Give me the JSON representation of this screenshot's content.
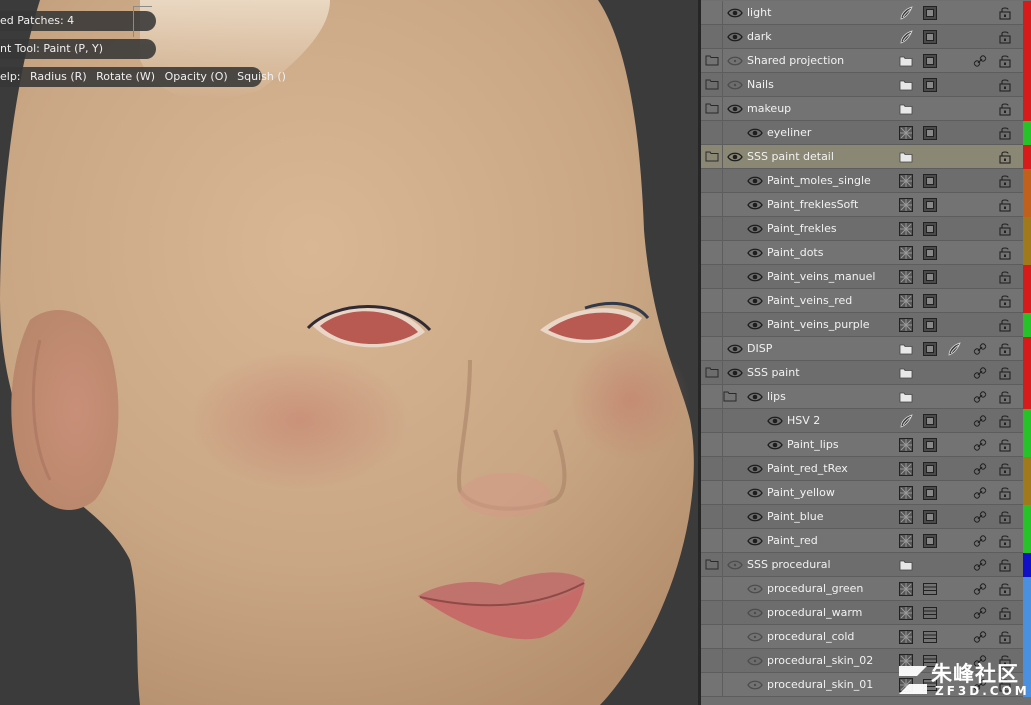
{
  "viewport": {
    "hud_patches": "ed Patches: 4",
    "hud_tool": "nt Tool: Paint (P, Y)",
    "hud_help_label": "elp:",
    "hud_help_items": [
      "Radius (R)",
      "Rotate (W)",
      "Opacity (O)",
      "Squish ()"
    ],
    "skin_color": "#c9a684",
    "background_color": "#3b3b3b"
  },
  "layers": [
    {
      "name": "light",
      "indent": 0,
      "folder": false,
      "eye": "on",
      "icons": [
        "brush",
        "mask"
      ],
      "lock": true,
      "color": "#d81a1a"
    },
    {
      "name": "dark",
      "indent": 0,
      "folder": false,
      "eye": "on",
      "icons": [
        "brush",
        "mask"
      ],
      "lock": true,
      "color": "#d81a1a"
    },
    {
      "name": "Shared projection",
      "indent": 0,
      "folder": true,
      "eye": "dim",
      "icons": [
        "folder",
        "mask"
      ],
      "link": true,
      "lock": true,
      "color": "#d81a1a"
    },
    {
      "name": "Nails",
      "indent": 0,
      "folder": true,
      "eye": "dim",
      "icons": [
        "folder",
        "mask"
      ],
      "lock": true,
      "color": "#d81a1a"
    },
    {
      "name": "makeup",
      "indent": 0,
      "folder": true,
      "eye": "on",
      "icons": [
        "folder"
      ],
      "lock": true,
      "color": "#d81a1a"
    },
    {
      "name": "eyeliner",
      "indent": 1,
      "folder": false,
      "eye": "on",
      "icons": [
        "fill",
        "mask"
      ],
      "lock": true,
      "color": "#27c227"
    },
    {
      "name": "SSS paint detail",
      "indent": 0,
      "folder": true,
      "eye": "on",
      "icons": [
        "folder"
      ],
      "lock": true,
      "color": "#d81a1a",
      "selected": true
    },
    {
      "name": "Paint_moles_single",
      "indent": 1,
      "folder": false,
      "eye": "on",
      "icons": [
        "fill",
        "mask"
      ],
      "lock": true,
      "color": "#c0601a"
    },
    {
      "name": "Paint_freklesSoft",
      "indent": 1,
      "folder": false,
      "eye": "on",
      "icons": [
        "fill",
        "mask"
      ],
      "lock": true,
      "color": "#c0601a"
    },
    {
      "name": "Paint_frekles",
      "indent": 1,
      "folder": false,
      "eye": "on",
      "icons": [
        "fill",
        "mask"
      ],
      "lock": true,
      "color": "#a07a1a"
    },
    {
      "name": "Paint_dots",
      "indent": 1,
      "folder": false,
      "eye": "on",
      "icons": [
        "fill",
        "mask"
      ],
      "lock": true,
      "color": "#a07a1a"
    },
    {
      "name": "Paint_veins_manuel",
      "indent": 1,
      "folder": false,
      "eye": "on",
      "icons": [
        "fill",
        "mask"
      ],
      "lock": true,
      "color": "#d81a1a"
    },
    {
      "name": "Paint_veins_red",
      "indent": 1,
      "folder": false,
      "eye": "on",
      "icons": [
        "fill",
        "mask"
      ],
      "lock": true,
      "color": "#d81a1a"
    },
    {
      "name": "Paint_veins_purple",
      "indent": 1,
      "folder": false,
      "eye": "on",
      "icons": [
        "fill",
        "mask"
      ],
      "lock": true,
      "color": "#27c227"
    },
    {
      "name": "DISP",
      "indent": 0,
      "folder": false,
      "eye": "on",
      "icons": [
        "folder",
        "mask",
        "brush"
      ],
      "link": true,
      "lock": true,
      "color": "#d81a1a"
    },
    {
      "name": "SSS paint",
      "indent": 0,
      "folder": true,
      "eye": "on",
      "icons": [
        "folder"
      ],
      "link": true,
      "lock": true,
      "color": "#d81a1a"
    },
    {
      "name": "lips",
      "indent": 1,
      "folder": true,
      "eye": "on",
      "icons": [
        "folder"
      ],
      "link": true,
      "lock": true,
      "color": "#d81a1a"
    },
    {
      "name": "HSV 2",
      "indent": 2,
      "folder": false,
      "eye": "on",
      "icons": [
        "brush",
        "mask"
      ],
      "link": true,
      "lock": true,
      "color": "#27c227"
    },
    {
      "name": "Paint_lips",
      "indent": 2,
      "folder": false,
      "eye": "on",
      "icons": [
        "fill",
        "mask"
      ],
      "link": true,
      "lock": true,
      "color": "#27c227"
    },
    {
      "name": "Paint_red_tRex",
      "indent": 1,
      "folder": false,
      "eye": "on",
      "icons": [
        "fill",
        "mask"
      ],
      "link": true,
      "lock": true,
      "color": "#a07a1a"
    },
    {
      "name": "Paint_yellow",
      "indent": 1,
      "folder": false,
      "eye": "on",
      "icons": [
        "fill",
        "mask"
      ],
      "link": true,
      "lock": true,
      "color": "#a07a1a"
    },
    {
      "name": "Paint_blue",
      "indent": 1,
      "folder": false,
      "eye": "on",
      "icons": [
        "fill",
        "mask"
      ],
      "link": true,
      "lock": true,
      "color": "#27c227"
    },
    {
      "name": "Paint_red",
      "indent": 1,
      "folder": false,
      "eye": "on",
      "icons": [
        "fill",
        "mask"
      ],
      "link": true,
      "lock": true,
      "color": "#27c227"
    },
    {
      "name": "SSS procedural",
      "indent": 0,
      "folder": true,
      "eye": "dim",
      "icons": [
        "folder"
      ],
      "link": true,
      "lock": true,
      "color": "#1010c8"
    },
    {
      "name": "procedural_green",
      "indent": 1,
      "folder": false,
      "eye": "dim",
      "icons": [
        "fill",
        "list"
      ],
      "link": true,
      "lock": true,
      "color": "#4a90e0"
    },
    {
      "name": "procedural_warm",
      "indent": 1,
      "folder": false,
      "eye": "dim",
      "icons": [
        "fill",
        "list"
      ],
      "link": true,
      "lock": true,
      "color": "#4a90e0"
    },
    {
      "name": "procedural_cold",
      "indent": 1,
      "folder": false,
      "eye": "dim",
      "icons": [
        "fill",
        "list"
      ],
      "link": true,
      "lock": true,
      "color": "#4a90e0"
    },
    {
      "name": "procedural_skin_02",
      "indent": 1,
      "folder": false,
      "eye": "dim",
      "icons": [
        "fill",
        "list"
      ],
      "link": true,
      "lock": true,
      "color": "#4a90e0"
    },
    {
      "name": "procedural_skin_01",
      "indent": 1,
      "folder": false,
      "eye": "dim",
      "icons": [
        "fill",
        "list"
      ],
      "link": true,
      "lock": true,
      "color": "#4a90e0"
    }
  ],
  "watermark": {
    "cn": "朱峰社区",
    "en": "ZF3D.COM"
  }
}
